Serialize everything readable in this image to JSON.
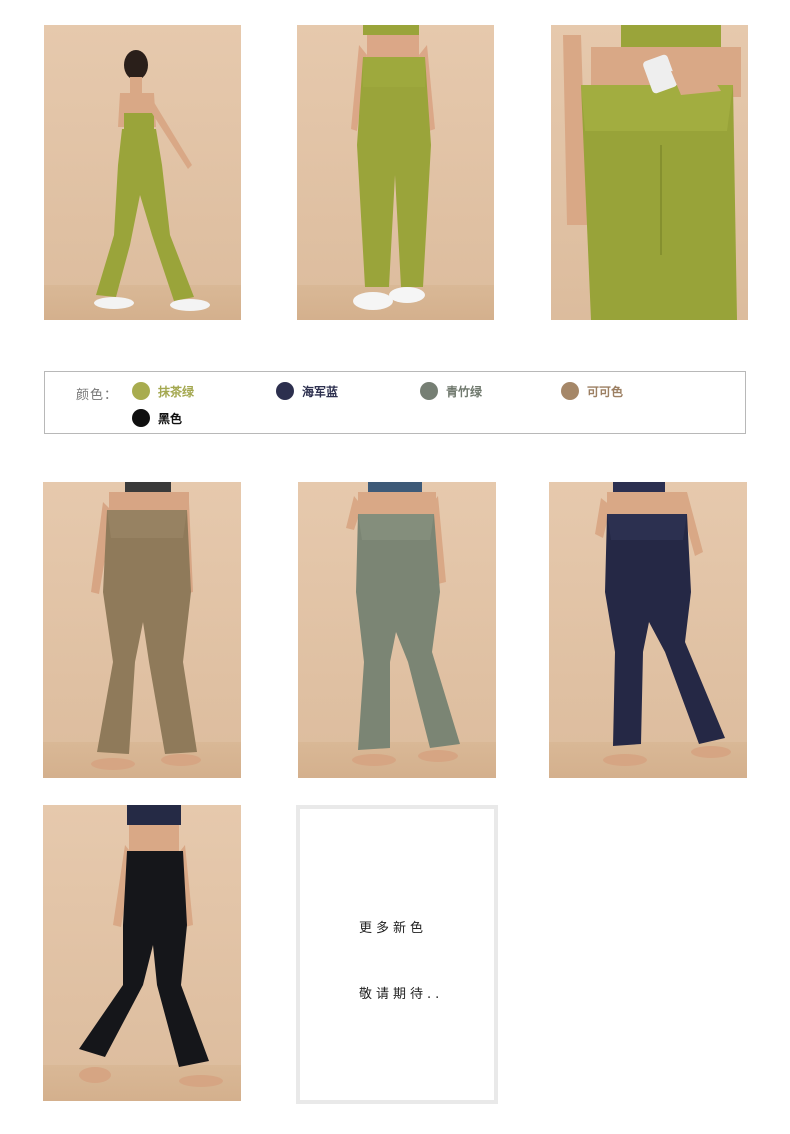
{
  "color_picker": {
    "label": "颜色：",
    "options": [
      {
        "name": "抹茶绿",
        "color": "#a8ac4f",
        "text_color": "#a4a850"
      },
      {
        "name": "海军蓝",
        "color": "#2c2f4e",
        "text_color": "#2c2f4e"
      },
      {
        "name": "青竹绿",
        "color": "#767f74",
        "text_color": "#6f786d"
      },
      {
        "name": "可可色",
        "color": "#a58768",
        "text_color": "#9c7f62"
      },
      {
        "name": "黑色",
        "color": "#0f0f0f",
        "text_color": "#111111"
      }
    ]
  },
  "more_colors": {
    "line1": "更多新色",
    "line2": "敬请期待.."
  },
  "photos": [
    {
      "id": "p1",
      "pants_color": "#9aa43a"
    },
    {
      "id": "p2",
      "pants_color": "#9aa43a"
    },
    {
      "id": "p3",
      "pants_color": "#98a339"
    },
    {
      "id": "p4",
      "pants_color": "#8f7a5a"
    },
    {
      "id": "p5",
      "pants_color": "#7b8574"
    },
    {
      "id": "p6",
      "pants_color": "#252845"
    },
    {
      "id": "p7",
      "pants_color": "#15161a"
    }
  ]
}
